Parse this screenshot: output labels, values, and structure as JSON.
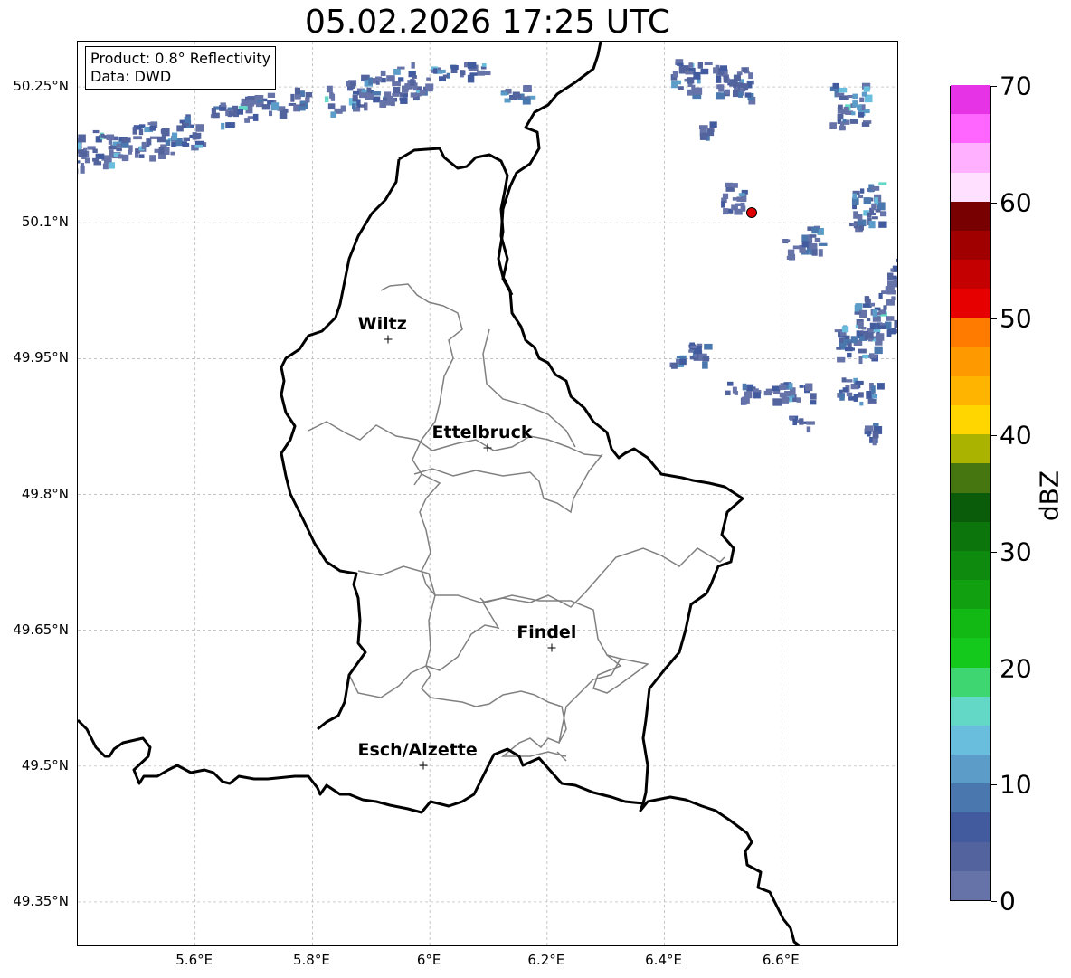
{
  "title": "05.02.2026 17:25 UTC",
  "info": {
    "product": "Product: 0.8° Reflectivity",
    "source": "Data: DWD"
  },
  "latitude_labels": [
    "50.25°N",
    "50.1°N",
    "49.95°N",
    "49.8°N",
    "49.65°N",
    "49.5°N",
    "49.35°N"
  ],
  "longitude_labels": [
    "5.6°E",
    "5.8°E",
    "6°E",
    "6.2°E",
    "6.4°E",
    "6.6°E"
  ],
  "map_extent": {
    "lon": [
      5.4,
      6.8
    ],
    "lat": [
      49.3,
      50.3
    ]
  },
  "cities": [
    {
      "name": "Wiltz",
      "lon": 5.93,
      "lat": 49.97
    },
    {
      "name": "Ettelbruck",
      "lon": 6.1,
      "lat": 49.85
    },
    {
      "name": "Findel",
      "lon": 6.21,
      "lat": 49.63
    },
    {
      "name": "Esch/Alzette",
      "lon": 5.99,
      "lat": 49.5
    }
  ],
  "radar_site": {
    "lon": 6.55,
    "lat": 50.11,
    "color": "#e00000"
  },
  "colorbar": {
    "unit": "dBZ",
    "min": 0,
    "max": 70,
    "step": 2.5,
    "tick_labels": [
      "0",
      "10",
      "20",
      "30",
      "40",
      "50",
      "60",
      "70"
    ],
    "colors": [
      "#6673a8",
      "#52639d",
      "#425a9e",
      "#4a78ae",
      "#5b9dc8",
      "#68bedc",
      "#63d8c6",
      "#3dd670",
      "#14c81c",
      "#12b814",
      "#10a010",
      "#0e8a0e",
      "#0c760c",
      "#0a5c0a",
      "#457610",
      "#aab300",
      "#ffd600",
      "#ffb500",
      "#ff9900",
      "#ff7b00",
      "#e60000",
      "#c40000",
      "#a00000",
      "#780000",
      "#ffe0ff",
      "#ffb0ff",
      "#ff66ff",
      "#e633e6"
    ]
  },
  "colors": {
    "border": "#000000",
    "canton": "#808080",
    "grid": "#b0b0b0"
  }
}
